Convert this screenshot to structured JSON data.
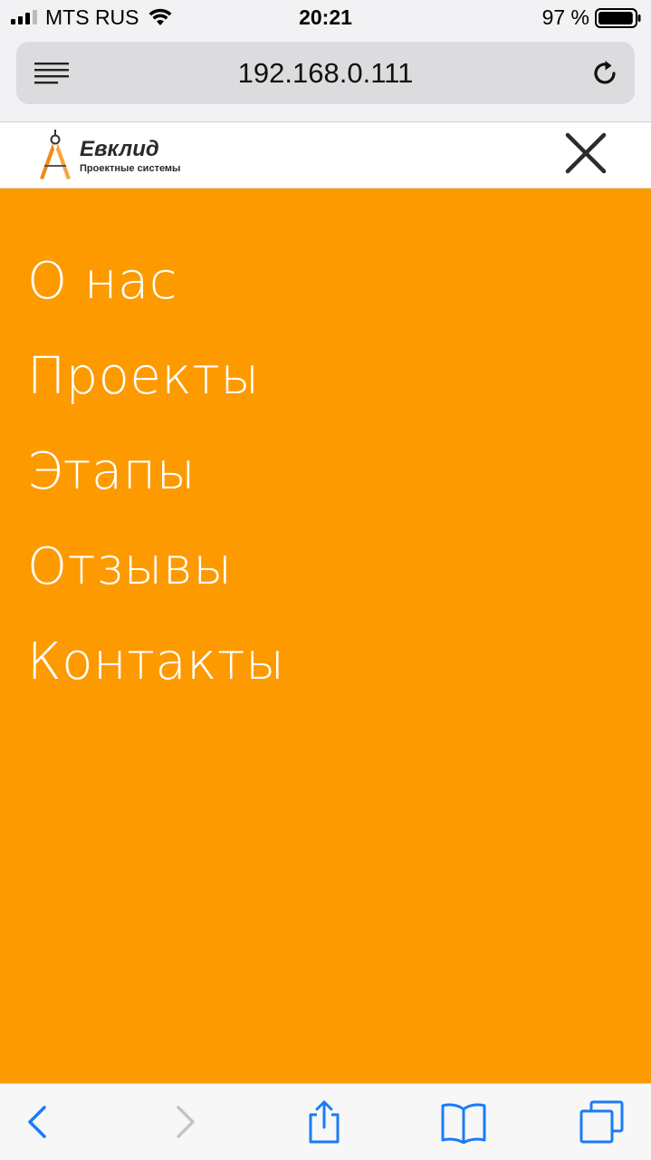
{
  "status_bar": {
    "carrier": "MTS RUS",
    "time": "20:21",
    "battery_percent": "97 %",
    "battery_level": 0.97
  },
  "browser": {
    "url": "192.168.0.111"
  },
  "site": {
    "logo": {
      "title": "Евклид",
      "subtitle": "Проектные системы"
    },
    "nav": {
      "items": [
        "О нас",
        "Проекты",
        "Этапы",
        "Отзывы",
        "Контакты"
      ]
    }
  },
  "colors": {
    "accent": "#fd9a00",
    "ios_blue": "#1a7cf5"
  },
  "icons": {
    "close": "close-icon",
    "back": "back-icon",
    "forward": "forward-icon",
    "share": "share-icon",
    "bookmarks": "bookmarks-icon",
    "tabs": "tabs-icon"
  }
}
